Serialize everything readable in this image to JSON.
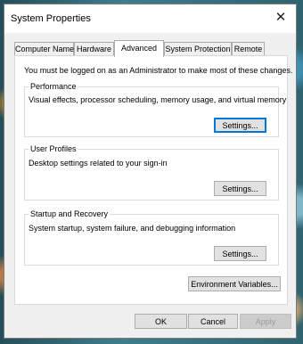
{
  "window": {
    "title": "System Properties",
    "close_glyph": "✕"
  },
  "tabs": [
    {
      "label": "Computer Name",
      "active": false
    },
    {
      "label": "Hardware",
      "active": false
    },
    {
      "label": "Advanced",
      "active": true
    },
    {
      "label": "System Protection",
      "active": false
    },
    {
      "label": "Remote",
      "active": false
    }
  ],
  "advanced": {
    "admin_note": "You must be logged on as an Administrator to make most of these changes.",
    "performance": {
      "title": "Performance",
      "description": "Visual effects, processor scheduling, memory usage, and virtual memory",
      "button": "Settings..."
    },
    "user_profiles": {
      "title": "User Profiles",
      "description": "Desktop settings related to your sign-in",
      "button": "Settings..."
    },
    "startup_recovery": {
      "title": "Startup and Recovery",
      "description": "System startup, system failure, and debugging information",
      "button": "Settings..."
    },
    "env_button": "Environment Variables..."
  },
  "footer": {
    "ok": "OK",
    "cancel": "Cancel",
    "apply": "Apply"
  },
  "colors": {
    "focus_accent": "#0078d7",
    "dialog_bg": "#f0f0f0"
  }
}
